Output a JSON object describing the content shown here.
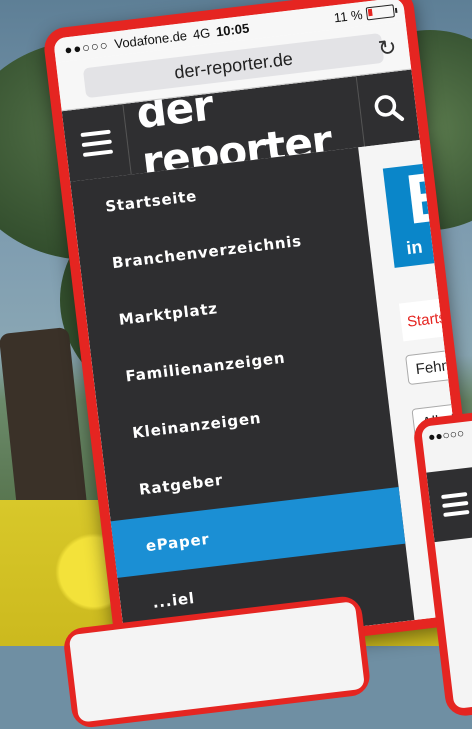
{
  "statusbar": {
    "signal": "●●○○○",
    "carrier": "Vodafone.de",
    "network": "4G",
    "time": "10:05",
    "battery": "11 %"
  },
  "browser": {
    "url": "der-reporter.de",
    "reload_icon": "reload-icon"
  },
  "header": {
    "logo": "der reporter",
    "menu_icon": "hamburger-icon",
    "search_icon": "search-icon"
  },
  "nav": {
    "items": [
      {
        "label": "Startseite"
      },
      {
        "label": "Branchenverzeichnis"
      },
      {
        "label": "Marktplatz"
      },
      {
        "label": "Familienanzeigen"
      },
      {
        "label": "Kleinanzeigen"
      },
      {
        "label": "Ratgeber"
      },
      {
        "label": "ePaper"
      },
      {
        "label": "...iel"
      }
    ],
    "active_index": 6
  },
  "page": {
    "banner_letter": "E",
    "banner_sub": "in",
    "breadcrumb": "Startseite",
    "select_region": "Fehmarn",
    "select_filter": "Alle Res"
  },
  "phone2": {
    "signal": "●●○○○"
  },
  "colors": {
    "brand_red": "#e52521",
    "nav_active": "#1b8fd4",
    "header_bg": "#2f2f31"
  }
}
